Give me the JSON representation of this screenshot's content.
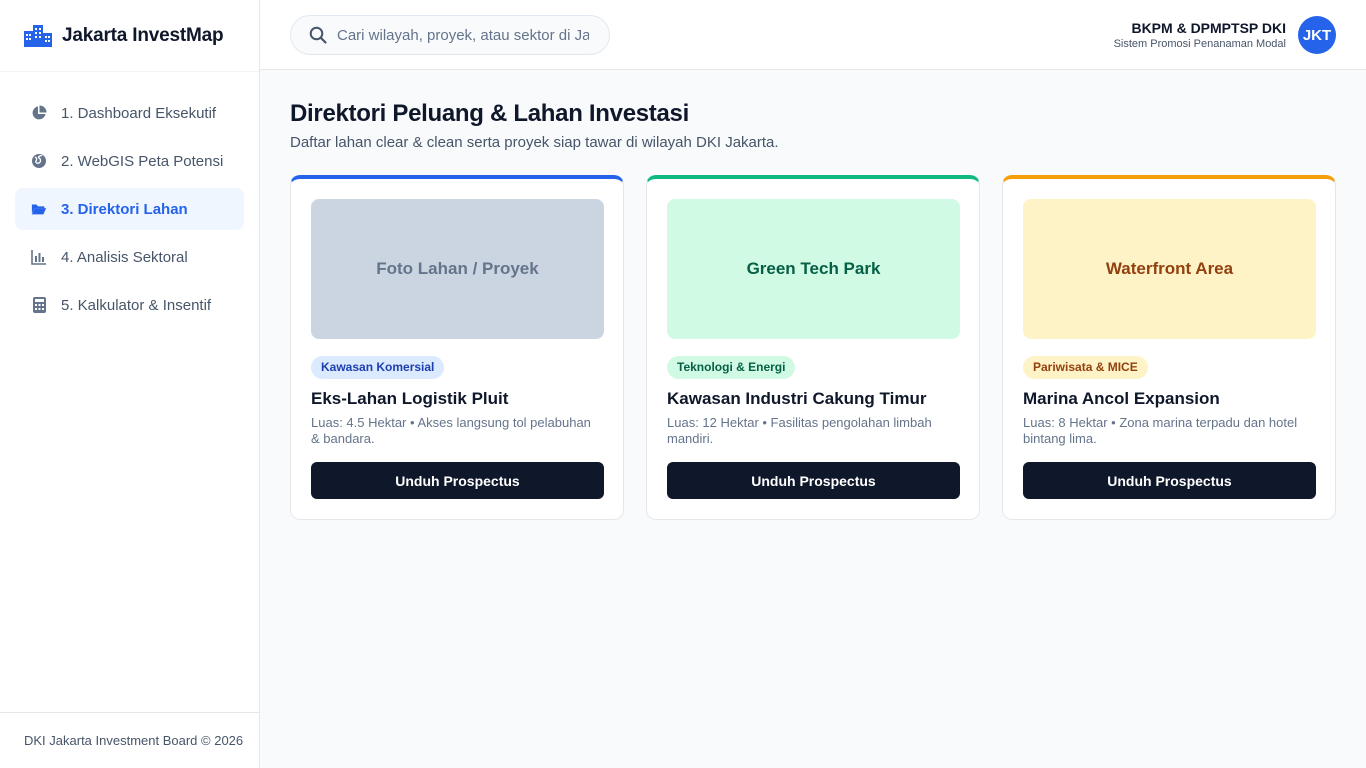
{
  "app": {
    "title": "Jakarta InvestMap",
    "brand_color": "#2563eb"
  },
  "sidebar": {
    "items": [
      {
        "label": "1. Dashboard Eksekutif",
        "icon": "pie-chart-icon",
        "active": false
      },
      {
        "label": "2. WebGIS Peta Potensi",
        "icon": "globe-icon",
        "active": false
      },
      {
        "label": "3. Direktori Lahan",
        "icon": "folder-open-icon",
        "active": true
      },
      {
        "label": "4. Analisis Sektoral",
        "icon": "bar-chart-icon",
        "active": false
      },
      {
        "label": "5. Kalkulator & Insentif",
        "icon": "calculator-icon",
        "active": false
      }
    ],
    "footer": "DKI Jakarta Investment Board © 2026"
  },
  "header": {
    "search_placeholder": "Cari wilayah, proyek, atau sektor di Jakarta...",
    "user_name": "BKPM & DPMPTSP DKI",
    "user_subtitle": "Sistem Promosi Penanaman Modal",
    "avatar_initials": "JKT"
  },
  "main": {
    "title": "Direktori Peluang & Lahan Investasi",
    "subtitle": "Daftar lahan clear & clean serta proyek siap tawar di wilayah DKI Jakarta.",
    "cards": [
      {
        "photo_label": "Foto Lahan / Proyek",
        "tag": "Kawasan Komersial",
        "title": "Eks-Lahan Logistik Pluit",
        "description": "Luas: 4.5 Hektar • Akses langsung tol pelabuhan & bandara.",
        "button": "Unduh Prospectus",
        "accent": "#2563eb"
      },
      {
        "photo_label": "Green Tech Park",
        "tag": "Teknologi & Energi",
        "title": "Kawasan Industri Cakung Timur",
        "description": "Luas: 12 Hektar • Fasilitas pengolahan limbah mandiri.",
        "button": "Unduh Prospectus",
        "accent": "#10b981"
      },
      {
        "photo_label": "Waterfront Area",
        "tag": "Pariwisata & MICE",
        "title": "Marina Ancol Expansion",
        "description": "Luas: 8 Hektar • Zona marina terpadu dan hotel bintang lima.",
        "button": "Unduh Prospectus",
        "accent": "#f59e0b"
      }
    ]
  }
}
